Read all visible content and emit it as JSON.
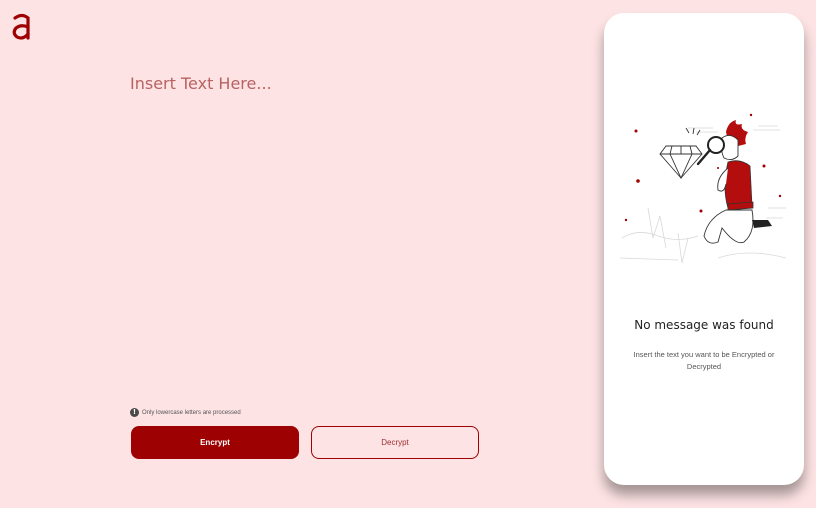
{
  "brand": {
    "logo_letter": "a",
    "accent_color": "#9e0101",
    "background_color": "#fde3e4"
  },
  "editor": {
    "placeholder": "Insert Text Here...",
    "value": ""
  },
  "notice": {
    "icon": "info-icon",
    "text": "Only lowercase letters are processed"
  },
  "actions": {
    "encrypt_label": "Encrypt",
    "decrypt_label": "Decrypt"
  },
  "output": {
    "illustration": "person-with-magnifying-glass-and-diamond",
    "title": "No message was found",
    "description": "Insert the text you want to be Encrypted or Decrypted"
  }
}
